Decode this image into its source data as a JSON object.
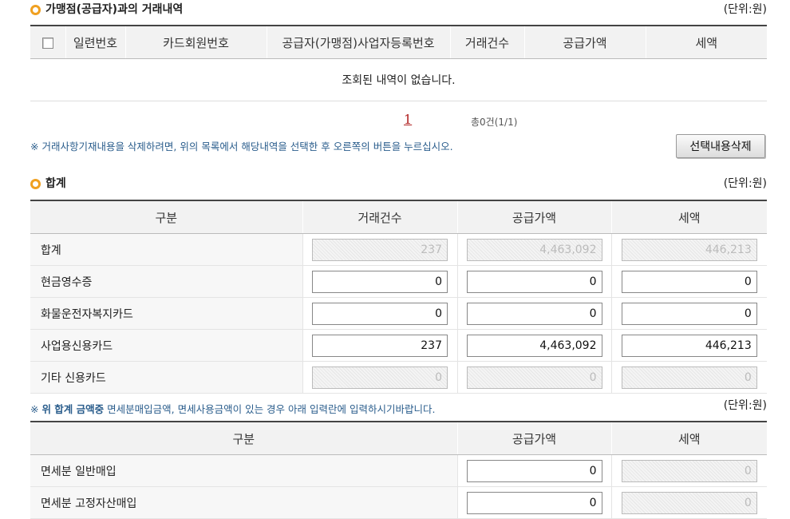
{
  "section1": {
    "title": "가맹점(공급자)과의 거래내역",
    "unit": "(단위:원)",
    "columns": [
      "일련번호",
      "카드회원번호",
      "공급자(가맹점)사업자등록번호",
      "거래건수",
      "공급가액",
      "세액"
    ],
    "empty_message": "조회된 내역이 없습니다."
  },
  "pager": {
    "current_page": "1",
    "total": "총0건(1/1)"
  },
  "notice1": "※ 거래사항기재내용을 삭제하려면, 위의 목록에서 해당내역을 선택한 후 오른쪽의 버튼을 누르십시오.",
  "delete_button": "선택내용삭제",
  "section2": {
    "title": "합계",
    "unit": "(단위:원)",
    "columns": [
      "구분",
      "거래건수",
      "공급가액",
      "세액"
    ],
    "rows": [
      {
        "label": "합계",
        "count": "237",
        "supply": "4,463,092",
        "tax": "446,213",
        "readonly": true
      },
      {
        "label": "현금영수증",
        "count": "0",
        "supply": "0",
        "tax": "0",
        "readonly": false
      },
      {
        "label": "화물운전자복지카드",
        "count": "0",
        "supply": "0",
        "tax": "0",
        "readonly": false
      },
      {
        "label": "사업용신용카드",
        "count": "237",
        "supply": "4,463,092",
        "tax": "446,213",
        "readonly": false
      },
      {
        "label": "기타 신용카드",
        "count": "0",
        "supply": "0",
        "tax": "0",
        "readonly": true
      }
    ]
  },
  "notice2": {
    "prefix": "※ ",
    "strong": "위 합계 금액중",
    "rest": " 면세분매입금액, 면세사용금액이 있는 경우 아래 입력란에 입력하시기바랍니다."
  },
  "section3": {
    "unit": "(단위:원)",
    "columns": [
      "구분",
      "공급가액",
      "세액"
    ],
    "rows": [
      {
        "label": "면세분 일반매입",
        "supply": "0",
        "tax": "0"
      },
      {
        "label": "면세분 고정자산매입",
        "supply": "0",
        "tax": "0"
      }
    ]
  }
}
